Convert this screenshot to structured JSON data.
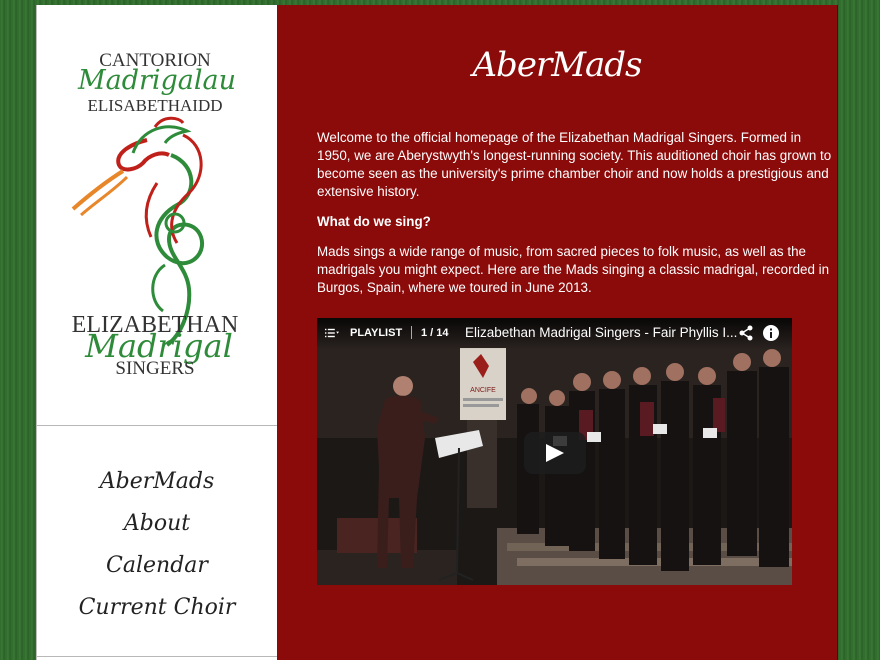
{
  "sidebar": {
    "logo": {
      "line1": "CANTORION",
      "line2": "Madrigalau",
      "line3": "ELISABETHAIDD",
      "line4": "ELIZABETHAN",
      "line5": "Madrigal",
      "line6": "SINGERS"
    },
    "nav": [
      {
        "label": "AberMads"
      },
      {
        "label": "About"
      },
      {
        "label": "Calendar"
      },
      {
        "label": "Current Choir"
      }
    ]
  },
  "main": {
    "title": "AberMads",
    "intro": "Welcome to the official homepage of the Elizabethan Madrigal Singers. Formed in 1950, we are Aberystwyth's longest-running society. This auditioned choir has grown to become seen as the university's prime chamber choir and now holds a prestigious and extensive history.",
    "question": "What do we sing?",
    "answer": "Mads sings a wide range of music, from sacred pieces to folk music, as well as the madrigals you might expect. Here are the Mads singing a classic madrigal, recorded in Burgos, Spain, where we toured in June 2013."
  },
  "video": {
    "playlist_label": "PLAYLIST",
    "playlist_count": "1 / 14",
    "title": "Elizabethan Madrigal Singers - Fair Phyllis I...",
    "banner_text": "ANCIFE"
  },
  "colors": {
    "main_bg": "#8b0a0a",
    "logo_green": "#2e8b3a",
    "logo_red": "#c0201a",
    "logo_orange": "#e8862a"
  },
  "icons": [
    "playlist-icon",
    "share-icon",
    "info-icon",
    "play-icon",
    "dragon-clef-logo-icon"
  ]
}
